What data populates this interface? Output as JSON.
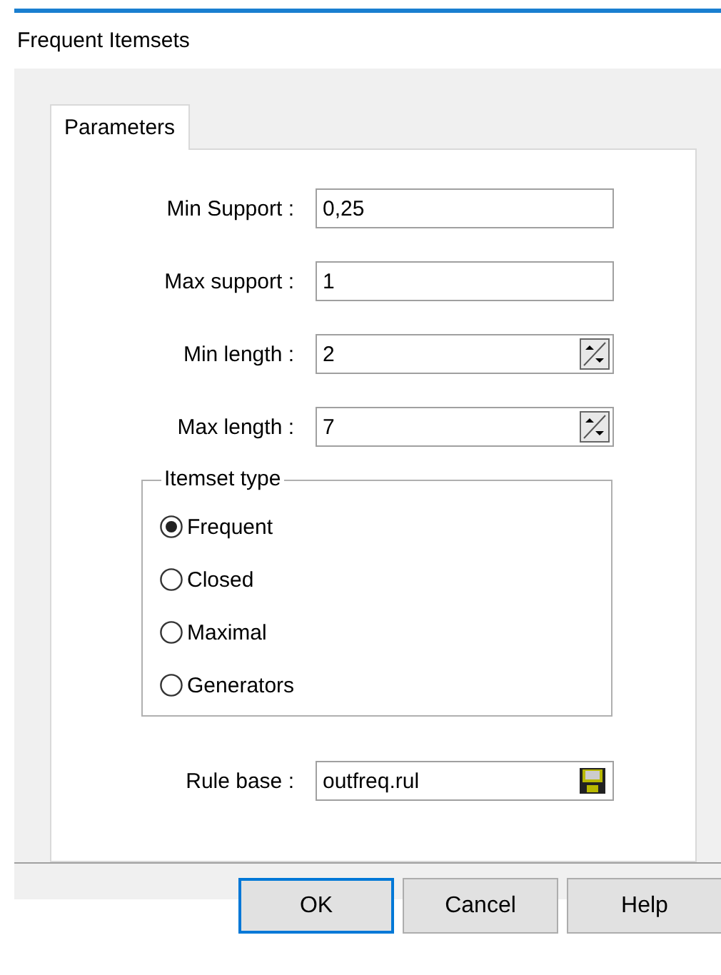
{
  "window": {
    "title": "Frequent Itemsets"
  },
  "tabs": [
    {
      "label": "Parameters",
      "selected": true
    }
  ],
  "fields": [
    {
      "label": "Min Support :",
      "value": "0,25",
      "kind": "text"
    },
    {
      "label": "Max support :",
      "value": "1",
      "kind": "text"
    },
    {
      "label": "Min length :",
      "value": "2",
      "kind": "spin"
    },
    {
      "label": "Max length :",
      "value": "7",
      "kind": "spin"
    }
  ],
  "itemset_type": {
    "title": "Itemset type",
    "options": [
      {
        "label": "Frequent",
        "selected": true
      },
      {
        "label": "Closed",
        "selected": false
      },
      {
        "label": "Maximal",
        "selected": false
      },
      {
        "label": "Generators",
        "selected": false
      }
    ]
  },
  "rule_base": {
    "label": "Rule base :",
    "value": "outfreq.rul"
  },
  "buttons": [
    {
      "label": "OK",
      "focused": true
    },
    {
      "label": "Cancel",
      "focused": false
    },
    {
      "label": "Help",
      "focused": false
    }
  ]
}
